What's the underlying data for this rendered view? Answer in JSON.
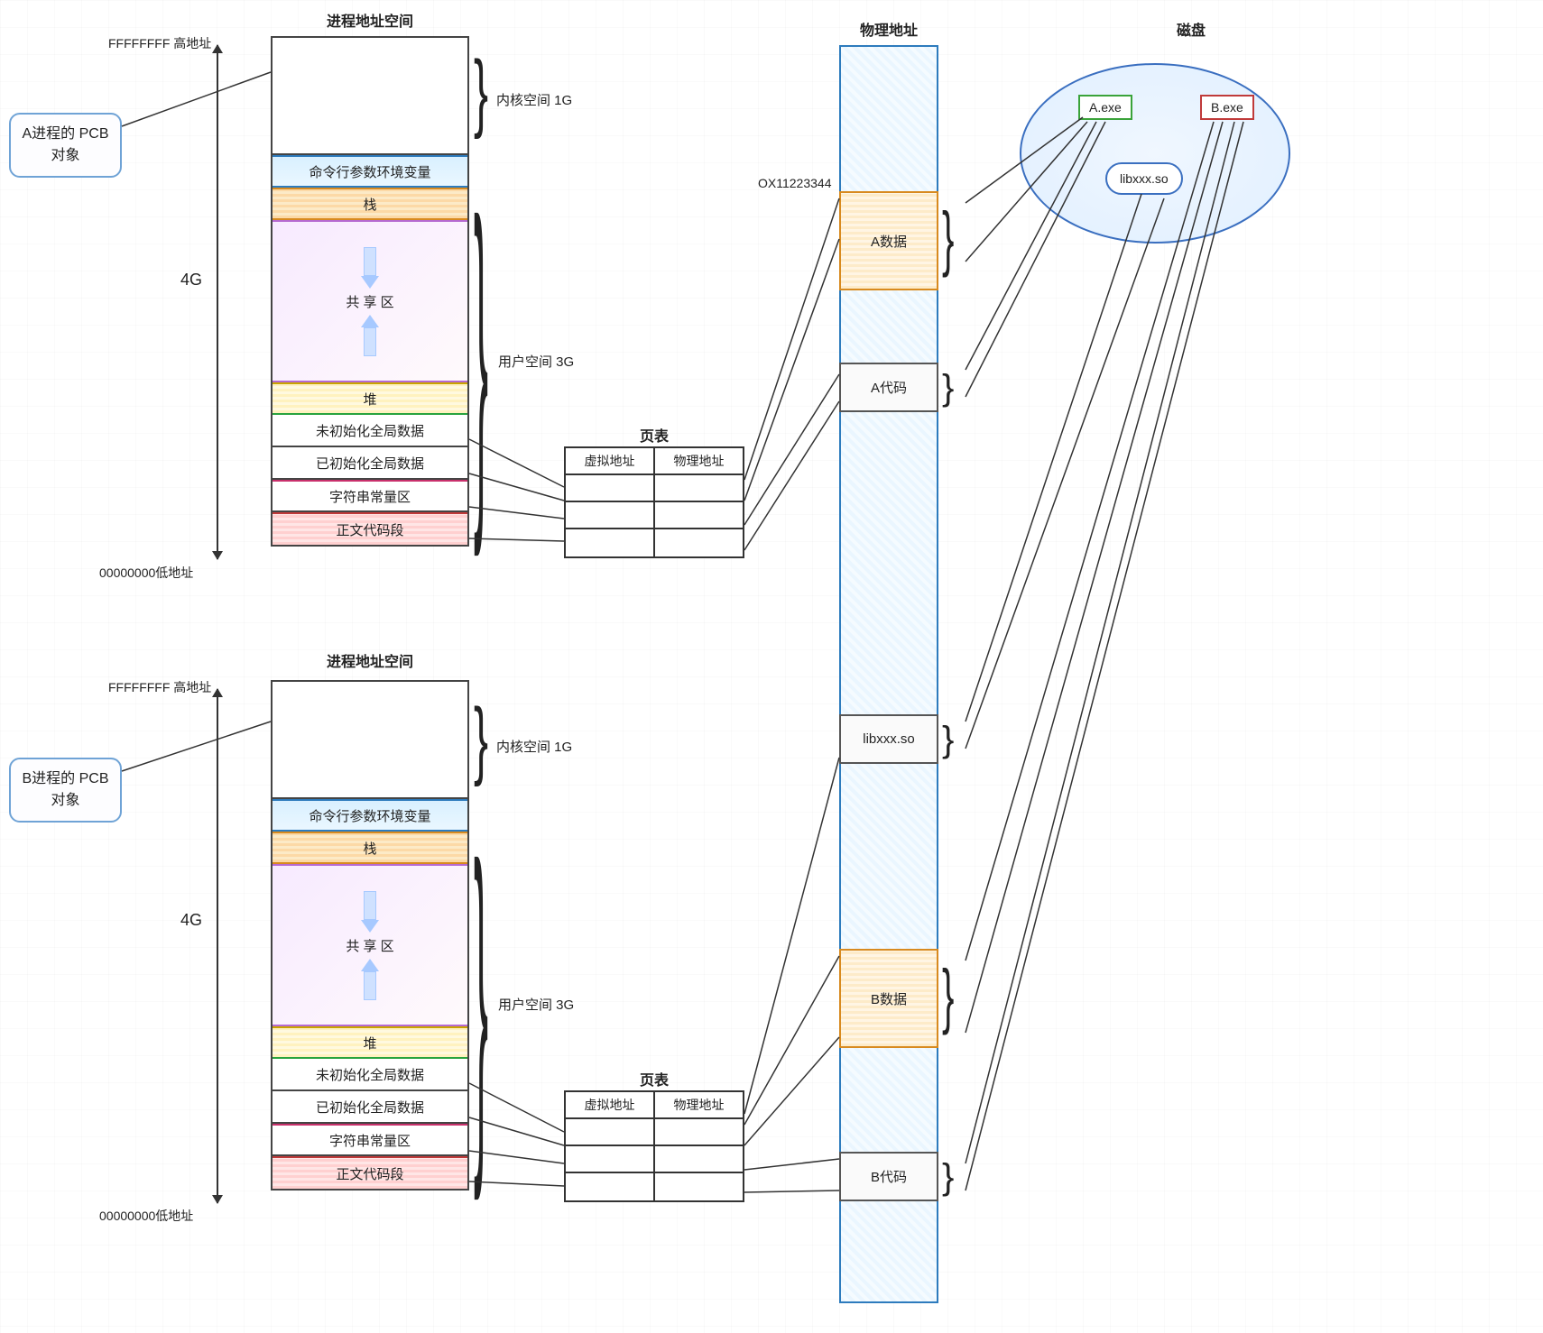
{
  "titles": {
    "addr_space": "进程地址空间",
    "phys": "物理地址",
    "disk": "磁盘",
    "page_table": "页表"
  },
  "pcb": {
    "a": "A进程的 PCB\n对象",
    "b": "B进程的 PCB\n对象"
  },
  "addr": {
    "high_label": "FFFFFFFF 高地址",
    "low_label": "00000000低地址",
    "size": "4G",
    "kernel_note": "内核空间 1G",
    "user_note": "用户空间 3G"
  },
  "segments": {
    "cmdline": "命令行参数环境变量",
    "stack": "栈",
    "mmap": "共 享 区",
    "heap": "堆",
    "bss": "未初始化全局数据",
    "data": "已初始化全局数据",
    "rodata": "字符串常量区",
    "text": "正文代码段"
  },
  "page_table": {
    "col_virtual": "虚拟地址",
    "col_physical": "物理地址"
  },
  "phys_mem": {
    "sample_addr": "OX11223344",
    "a_data": "A数据",
    "a_code": "A代码",
    "lib": "libxxx.so",
    "b_data": "B数据",
    "b_code": "B代码"
  },
  "disk": {
    "file_a": "A.exe",
    "file_b": "B.exe",
    "lib": "libxxx.so"
  }
}
